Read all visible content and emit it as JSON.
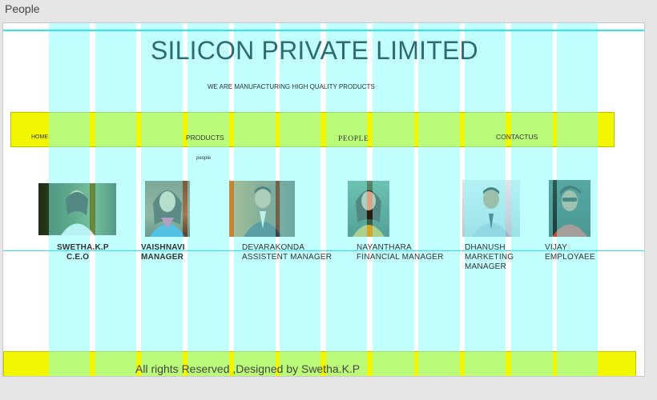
{
  "window": {
    "title": "People"
  },
  "header": {
    "company": "SILICON PRIVATE LIMITED",
    "tagline": "WE ARE MANUFACTURING HIGH QUALITY PRODUCTS"
  },
  "nav": {
    "items": [
      {
        "label": "HOME"
      },
      {
        "label": "PRODUCTS"
      },
      {
        "label": "PEOPLE"
      },
      {
        "label": "CONTACTUS"
      }
    ],
    "sub_label": "people"
  },
  "people": [
    {
      "name": "SWETHA.K.P",
      "role": "C.E.O"
    },
    {
      "name": "VAISHNAVI",
      "role": "MANAGER"
    },
    {
      "name": "DEVARAKONDA",
      "role": "ASSISTENT MANAGER"
    },
    {
      "name": "NAYANTHARA",
      "role": "FINANCIAL MANAGER"
    },
    {
      "name": "DHANUSH",
      "role": "MARKETING",
      "role2": "MANAGER"
    },
    {
      "name": "VIJAY",
      "role": "EMPLOYAEE"
    }
  ],
  "footer": {
    "text": "All rights Reserved ,Designed by Swetha.K.P"
  },
  "colors": {
    "accent_yellow": "#f2f700",
    "guide_cyan": "#2fe6ee",
    "title_color": "#2b6c73"
  }
}
